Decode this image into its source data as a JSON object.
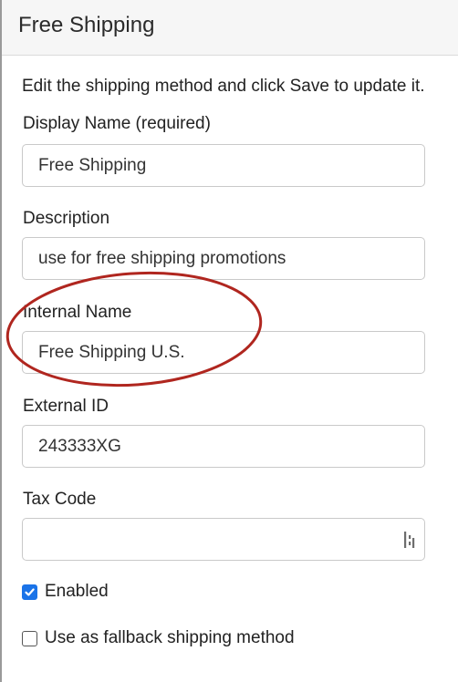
{
  "header": {
    "title": "Free Shipping"
  },
  "intro": "Edit the shipping method and click Save to update it.",
  "fields": {
    "display_name": {
      "label": "Display Name (required)",
      "value": "Free Shipping"
    },
    "description": {
      "label": "Description",
      "value": "use for free shipping promotions"
    },
    "internal_name": {
      "label": "Internal Name",
      "value": "Free Shipping U.S."
    },
    "external_id": {
      "label": "External ID",
      "value": "243333XG"
    },
    "tax_code": {
      "label": "Tax Code",
      "value": "",
      "icon": "select-handle-icon"
    }
  },
  "options": {
    "enabled": {
      "label": "Enabled",
      "checked": true
    },
    "fallback": {
      "label": "Use as fallback shipping method",
      "checked": false
    }
  },
  "colors": {
    "checkbox_checked": "#1a73e8",
    "annotation_circle": "#b0261f"
  }
}
